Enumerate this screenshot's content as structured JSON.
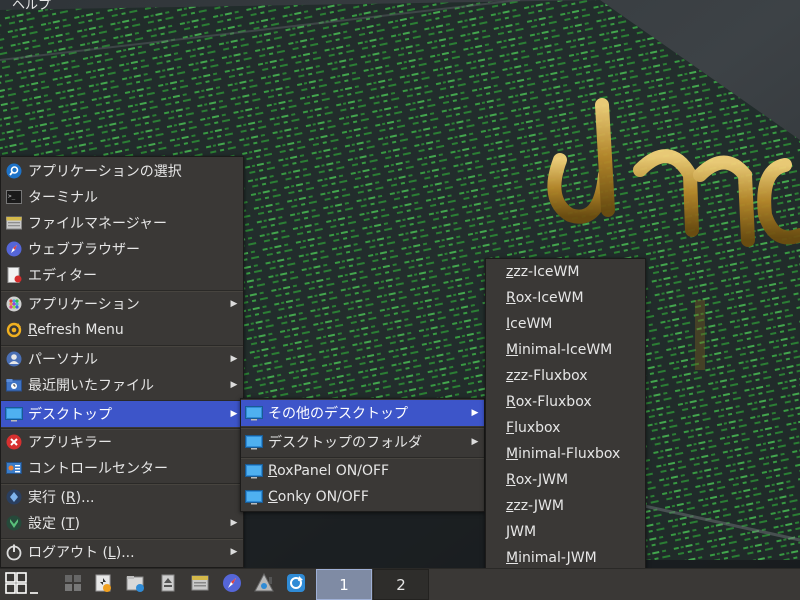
{
  "desktop": {
    "help_label": "ヘルプ"
  },
  "main_menu": {
    "items": [
      {
        "label": "アプリケーションの選択",
        "icon": "app-finder-icon"
      },
      {
        "label": "ターミナル",
        "icon": "terminal-icon"
      },
      {
        "label": "ファイルマネージャー",
        "icon": "file-manager-icon"
      },
      {
        "label": "ウェブブラウザー",
        "icon": "web-browser-icon"
      },
      {
        "label": "エディター",
        "icon": "text-editor-icon"
      },
      {
        "label": "アプリケーション",
        "icon": "applications-icon",
        "submenu": true
      },
      {
        "label_pre": "",
        "label_u": "R",
        "label_post": "efresh Menu",
        "icon": "refresh-icon"
      },
      {
        "label": "パーソナル",
        "icon": "personal-icon",
        "submenu": true
      },
      {
        "label": "最近開いたファイル",
        "icon": "recent-files-icon",
        "submenu": true
      },
      {
        "label": "デスクトップ",
        "icon": "desktop-icon",
        "submenu": true,
        "selected": true
      },
      {
        "label": "アプリキラー",
        "icon": "app-killer-icon"
      },
      {
        "label": "コントロールセンター",
        "icon": "control-center-icon"
      },
      {
        "label_pre": "実行 (",
        "label_u": "R",
        "label_post": ")...",
        "icon": "run-icon"
      },
      {
        "label_pre": "設定 (",
        "label_u": "T",
        "label_post": ")",
        "icon": "settings-icon",
        "submenu": true
      },
      {
        "label_pre": "ログアウト (",
        "label_u": "L",
        "label_post": ")...",
        "icon": "logout-icon",
        "submenu": true
      }
    ]
  },
  "desktop_menu": {
    "items": [
      {
        "label": "その他のデスクトップ",
        "submenu": true,
        "selected": true
      },
      {
        "label": "デスクトップのフォルダ",
        "submenu": true
      },
      {
        "label_pre": "",
        "label_u": "R",
        "label_post": "oxPanel ON/OFF"
      },
      {
        "label_pre": "",
        "label_u": "C",
        "label_post": "onky ON/OFF"
      }
    ]
  },
  "other_desktops_menu": {
    "items": [
      {
        "u": "z",
        "rest": "zz-IceWM"
      },
      {
        "u": "R",
        "rest": "ox-IceWM"
      },
      {
        "u": "I",
        "rest": "ceWM"
      },
      {
        "u": "M",
        "rest": "inimal-IceWM"
      },
      {
        "u": "z",
        "rest": "zz-Fluxbox"
      },
      {
        "u": "R",
        "rest": "ox-Fluxbox"
      },
      {
        "u": "F",
        "rest": "luxbox"
      },
      {
        "u": "M",
        "rest": "inimal-Fluxbox"
      },
      {
        "u": "R",
        "rest": "ox-JWM"
      },
      {
        "u": "z",
        "rest": "zz-JWM"
      },
      {
        "u": "J",
        "rest": "WM"
      },
      {
        "u": "M",
        "rest": "inimal-JWM"
      }
    ]
  },
  "taskbar": {
    "launchers": [
      "menu-icon",
      "show-desktop-icon",
      "windows-icon",
      "installer-icon",
      "file-manager-icon",
      "eject-icon",
      "archive-icon",
      "web-browser-icon",
      "tool-icon",
      "update-icon"
    ],
    "workspaces": [
      {
        "label": "1",
        "active": true
      },
      {
        "label": "2",
        "active": false
      }
    ]
  },
  "colors": {
    "menu_bg": "#3a3836",
    "selection": "#3d55c9",
    "taskbar_bg": "#3a3836",
    "active_workspace": "#7f8ba4"
  }
}
